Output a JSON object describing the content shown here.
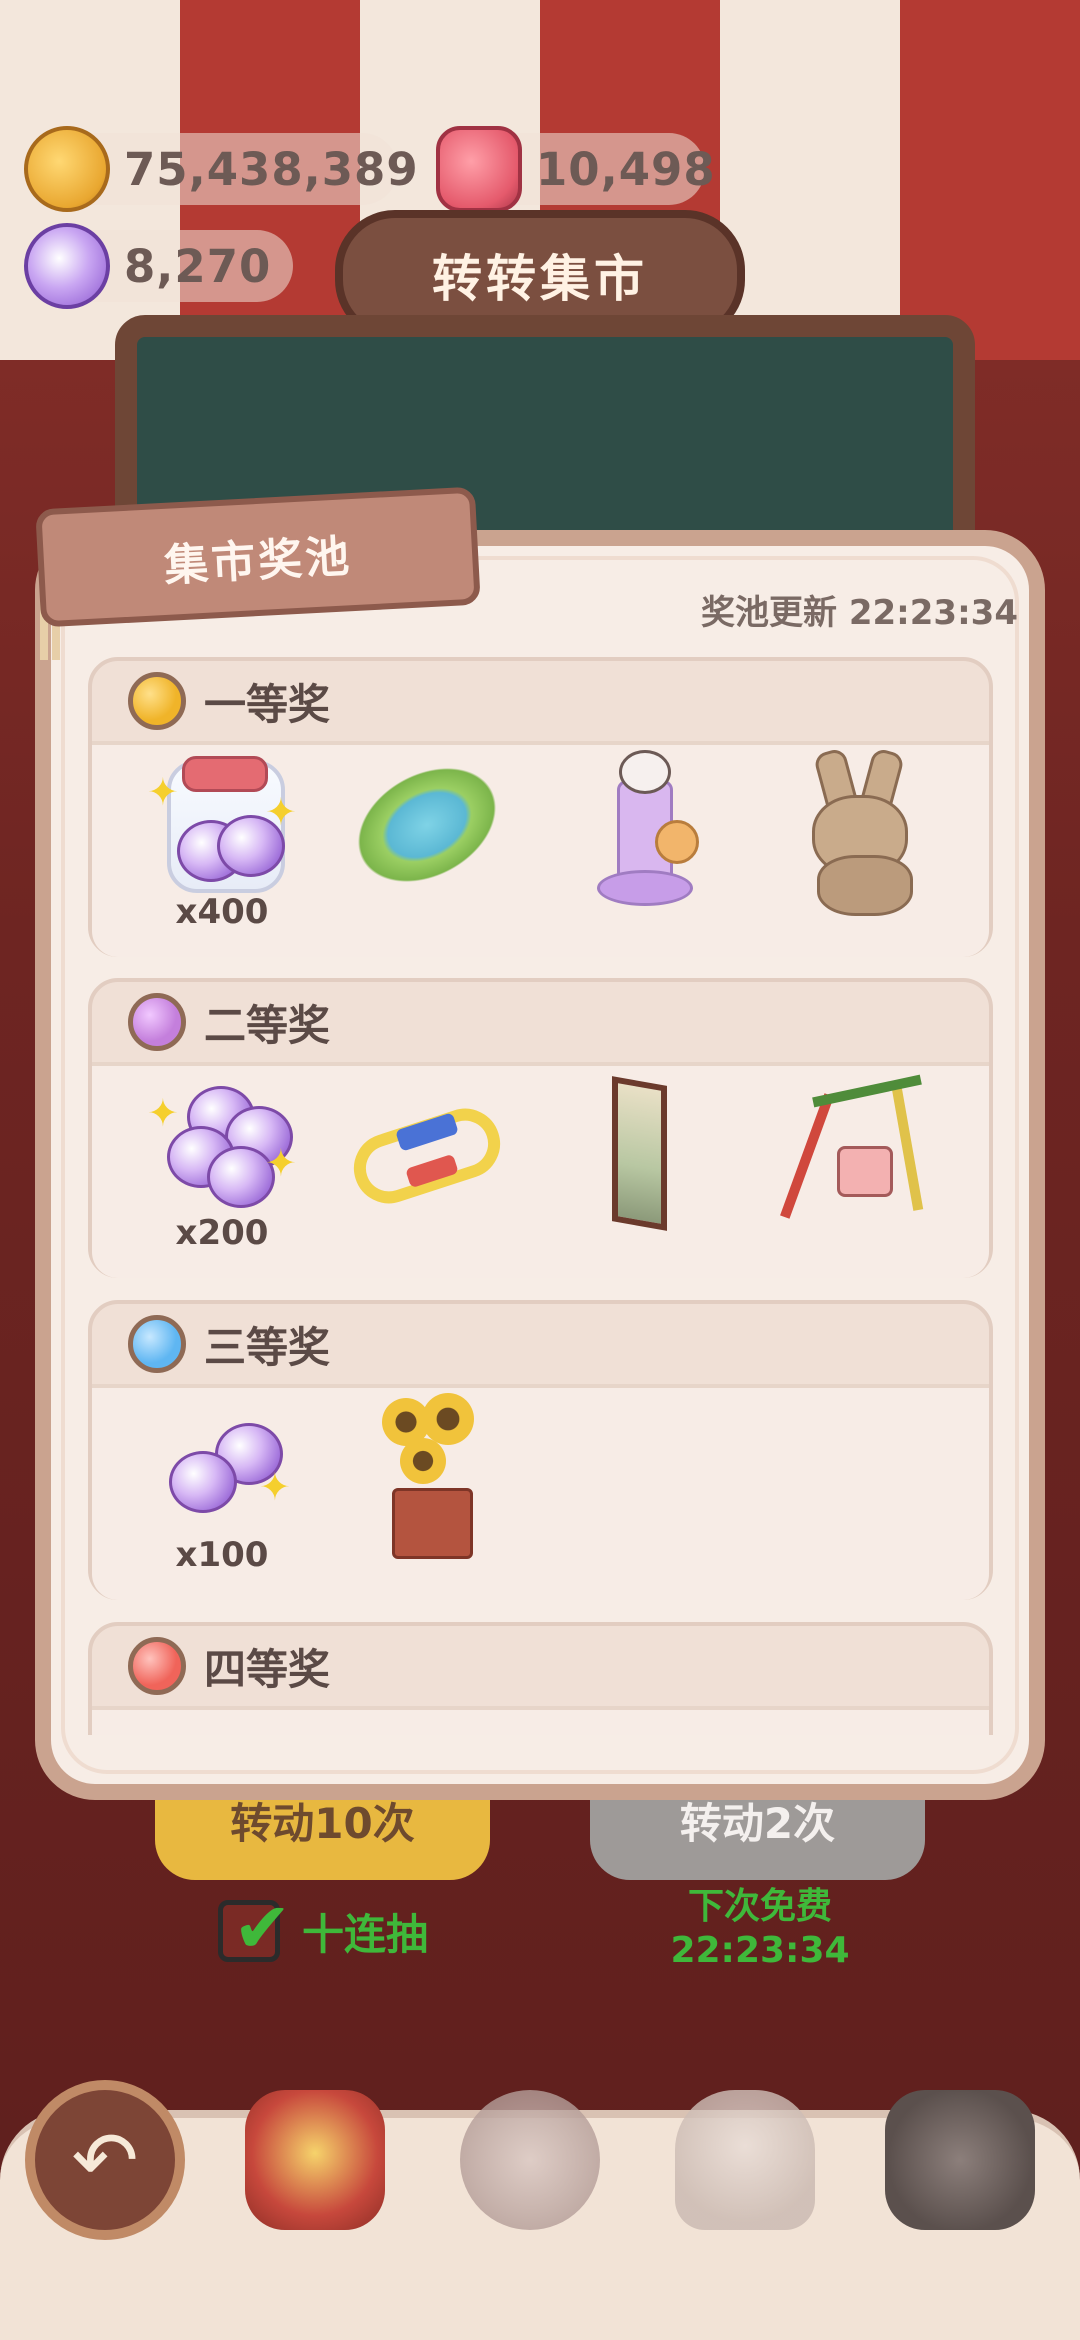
{
  "currencies": {
    "coins": "75,438,389",
    "gems": "10,498",
    "crystals": "8,270"
  },
  "screen_title": "转转集市",
  "buttons": {
    "spin10": "转动10次",
    "spin2": "转动2次"
  },
  "ten_draw_label": "十连抽",
  "next_free_label": "下次免费",
  "next_free_time": "22:23:34",
  "modal": {
    "tag": "集市奖池",
    "refresh": "奖池更新 22:23:34",
    "tiers": [
      {
        "title": "一等奖",
        "color": "#f0b429",
        "items": [
          {
            "icon": "crystal-jar-icon",
            "qty": "x400"
          },
          {
            "icon": "pond-icon",
            "qty": ""
          },
          {
            "icon": "cat-tower-icon",
            "qty": ""
          },
          {
            "icon": "bunny-plush-icon",
            "qty": ""
          }
        ]
      },
      {
        "title": "二等奖",
        "color": "#c47fdc",
        "items": [
          {
            "icon": "crystal-pile-icon",
            "qty": "x200"
          },
          {
            "icon": "toy-train-icon",
            "qty": ""
          },
          {
            "icon": "wall-scroll-icon",
            "qty": ""
          },
          {
            "icon": "swing-icon",
            "qty": ""
          }
        ]
      },
      {
        "title": "三等奖",
        "color": "#5fb6f2",
        "items": [
          {
            "icon": "crystal-pair-icon",
            "qty": "x100"
          },
          {
            "icon": "sunflower-pot-icon",
            "qty": ""
          }
        ]
      },
      {
        "title": "四等奖",
        "color": "#f0645a",
        "items": []
      }
    ]
  }
}
